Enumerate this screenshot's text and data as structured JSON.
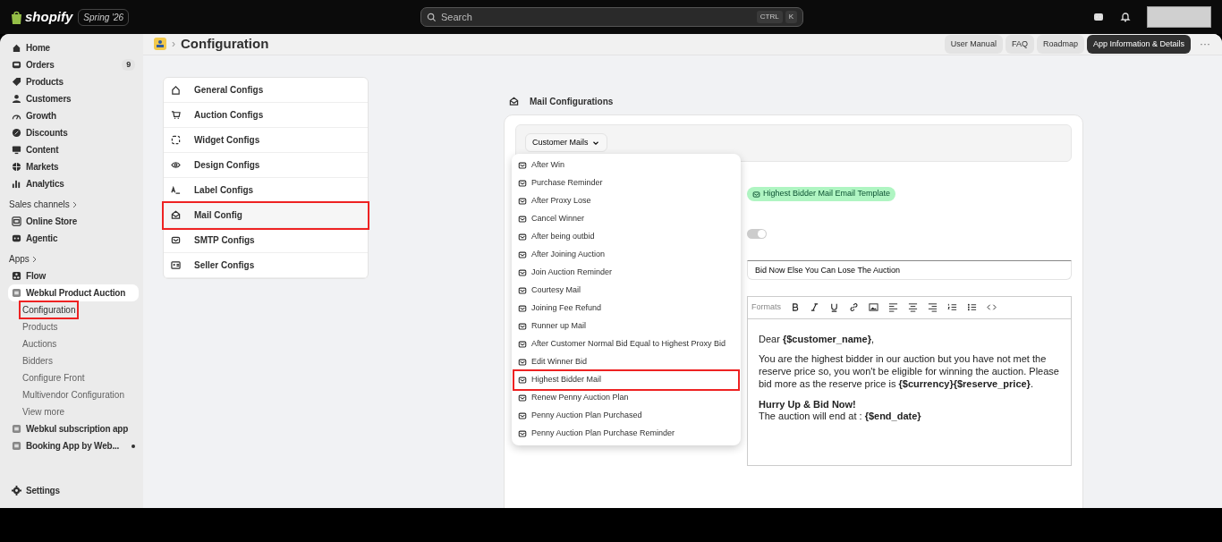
{
  "topbar": {
    "brand": "shopify",
    "edition": "Spring '26",
    "search": {
      "placeholder": "Search",
      "keys": [
        "CTRL",
        "K"
      ]
    }
  },
  "sidebar": {
    "items": [
      {
        "label": "Home",
        "selected": false
      },
      {
        "label": "Orders",
        "badge": "9",
        "selected": false
      },
      {
        "label": "Products",
        "selected": false
      },
      {
        "label": "Customers",
        "selected": false
      },
      {
        "label": "Growth",
        "selected": false
      },
      {
        "label": "Discounts",
        "selected": false
      },
      {
        "label": "Content",
        "selected": false
      },
      {
        "label": "Markets",
        "selected": false
      },
      {
        "label": "Analytics",
        "selected": false
      }
    ],
    "sections": [
      {
        "title": "Sales channels",
        "items": [
          {
            "label": "Online Store",
            "selected": false
          },
          {
            "label": "Agentic",
            "selected": false
          }
        ]
      },
      {
        "title": "Apps",
        "items": [
          {
            "label": "Flow",
            "selected": false
          },
          {
            "label": "Webkul Product Auction",
            "selected": true,
            "children": [
              {
                "label": "Configuration",
                "selected": true
              },
              {
                "label": "Products",
                "selected": false
              },
              {
                "label": "Auctions",
                "selected": false
              },
              {
                "label": "Bidders",
                "selected": false
              },
              {
                "label": "Configure Front",
                "selected": false
              },
              {
                "label": "Multivendor Configuration",
                "selected": false
              },
              {
                "label": "View more",
                "selected": false
              }
            ]
          },
          {
            "label": "Webkul subscription app",
            "selected": false
          },
          {
            "label": "Booking App by Web...",
            "selected": false,
            "dot": true
          }
        ]
      }
    ],
    "settings": "Settings"
  },
  "header": {
    "title": "Configuration",
    "separator": "›",
    "buttons": [
      {
        "label": "User Manual",
        "kind": "plain"
      },
      {
        "label": "FAQ",
        "kind": "plain"
      },
      {
        "label": "Roadmap",
        "kind": "plain"
      },
      {
        "label": "App Information & Details",
        "kind": "primary"
      }
    ],
    "more": "···"
  },
  "config_menu": [
    {
      "label": "General Configs",
      "selected": false
    },
    {
      "label": "Auction Configs",
      "selected": false
    },
    {
      "label": "Widget Configs",
      "selected": false
    },
    {
      "label": "Design Configs",
      "selected": false
    },
    {
      "label": "Label Configs",
      "selected": false
    },
    {
      "label": "Mail Config",
      "selected": true
    },
    {
      "label": "SMTP Configs",
      "selected": false
    },
    {
      "label": "Seller Configs",
      "selected": false
    }
  ],
  "mail": {
    "title": "Mail Configurations",
    "category": "Customer Mails",
    "dropdown": [
      {
        "label": "After Win",
        "selected": false
      },
      {
        "label": "Purchase Reminder",
        "selected": false
      },
      {
        "label": "After Proxy Lose",
        "selected": false
      },
      {
        "label": "Cancel Winner",
        "selected": false
      },
      {
        "label": "After being outbid",
        "selected": false
      },
      {
        "label": "After Joining Auction",
        "selected": false
      },
      {
        "label": "Join Auction Reminder",
        "selected": false
      },
      {
        "label": "Courtesy Mail",
        "selected": false
      },
      {
        "label": "Joining Fee Refund",
        "selected": false
      },
      {
        "label": "Runner up Mail",
        "selected": false
      },
      {
        "label": "After Customer Normal Bid Equal to Highest Proxy Bid",
        "selected": false
      },
      {
        "label": "Edit Winner Bid",
        "selected": false
      },
      {
        "label": "Highest Bidder Mail",
        "selected": true
      },
      {
        "label": "Renew Penny Auction Plan",
        "selected": false
      },
      {
        "label": "Penny Auction Plan Purchased",
        "selected": false
      },
      {
        "label": "Penny Auction Plan Purchase Reminder",
        "selected": false
      }
    ],
    "template_name": "Highest Bidder Mail Email Template",
    "status_on": true,
    "subject": "Bid Now Else You Can Lose The Auction",
    "toolbar": {
      "formats": "Formats"
    },
    "content": [
      {
        "kind": "para",
        "text": "Dear **{$customer_name}**,"
      },
      {
        "kind": "para",
        "text": "You are the highest bidder in our auction but you have not met the reserve price so, you won't be eligible for winning the auction. Please bid more as the reserve price is **{$currency}{$reserve_price}**."
      },
      {
        "kind": "heading",
        "text": "Hurry Up & Bid Now!"
      },
      {
        "kind": "line",
        "text": "The auction will end at : **{$end_date}**"
      }
    ]
  }
}
